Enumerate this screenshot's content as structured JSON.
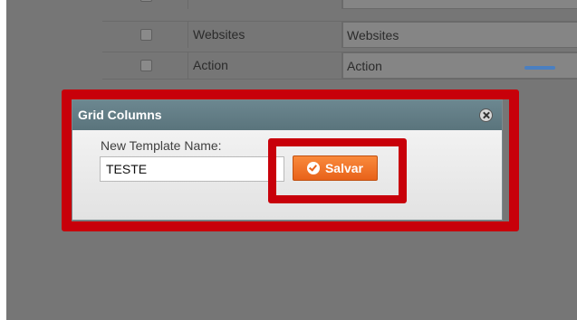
{
  "grid": {
    "rows": [
      {
        "name": "",
        "value": ""
      },
      {
        "name": "Websites",
        "value": "Websites"
      },
      {
        "name": "Action",
        "value": "Action"
      }
    ]
  },
  "dialog": {
    "title": "Grid Columns",
    "field_label": "New Template Name:",
    "field_value": "TESTE",
    "save_label": "Salvar"
  },
  "colors": {
    "annotation_red": "#c8000a",
    "save_orange": "#f07428",
    "header_teal": "#627e86"
  },
  "icons": [
    "close-icon",
    "check-circle-icon",
    "checkbox-icon"
  ]
}
